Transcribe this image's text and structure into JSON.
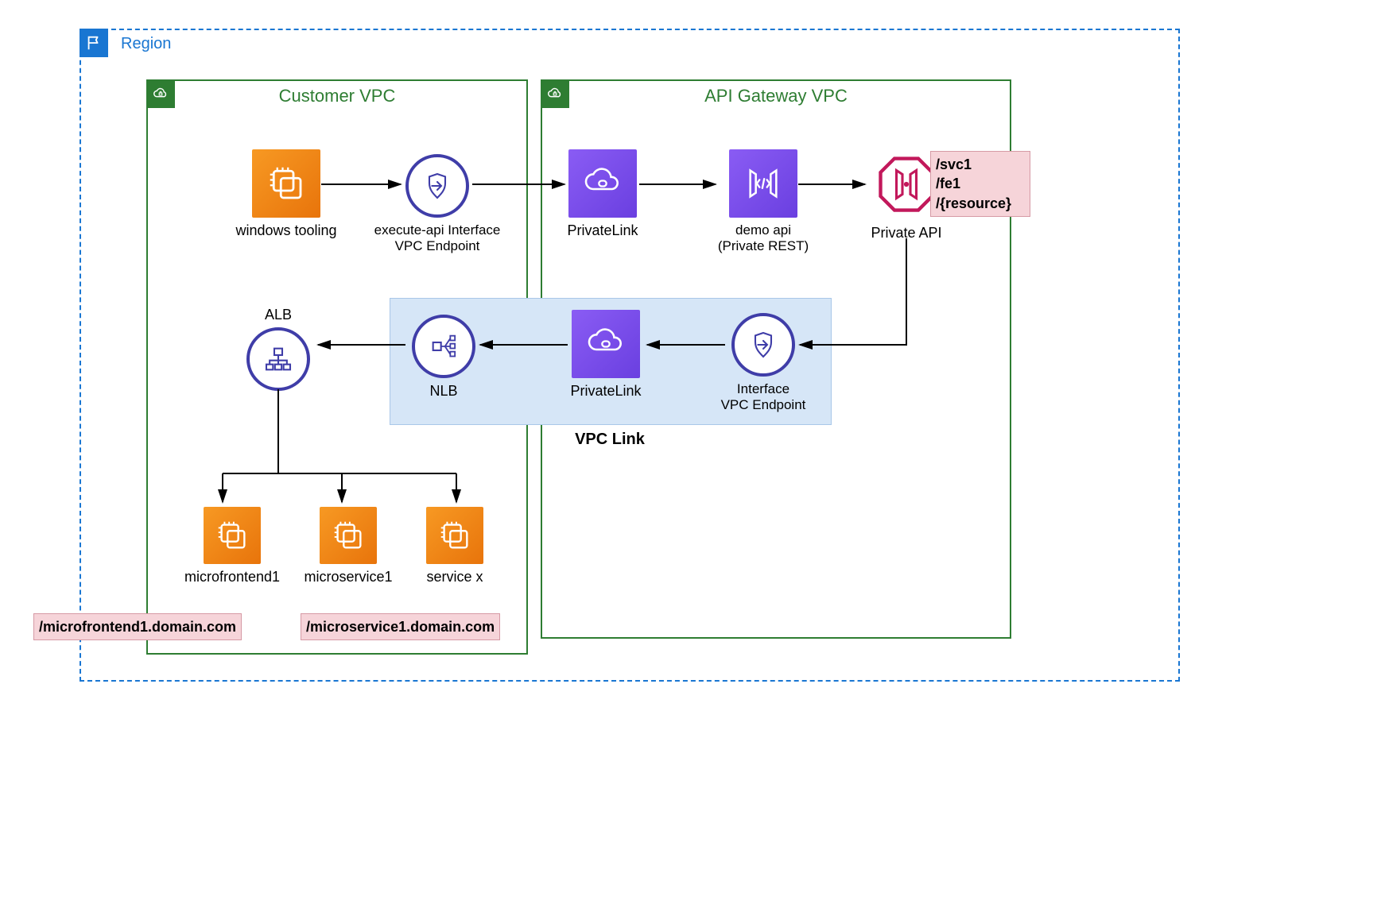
{
  "region": {
    "label": "Region"
  },
  "customer_vpc": {
    "label": "Customer VPC"
  },
  "apigw_vpc": {
    "label": "API Gateway VPC"
  },
  "vpclink": {
    "label": "VPC Link"
  },
  "nodes": {
    "windows_tooling": {
      "label": "windows tooling"
    },
    "execapi_endpoint": {
      "label_l1": "execute-api Interface",
      "label_l2": "VPC Endpoint"
    },
    "privatelink_top": {
      "label": "PrivateLink"
    },
    "demo_api": {
      "label_l1": "demo api",
      "label_l2": "(Private REST)"
    },
    "private_api": {
      "label": "Private API"
    },
    "alb": {
      "label": "ALB"
    },
    "nlb": {
      "label": "NLB"
    },
    "privatelink_mid": {
      "label": "PrivateLink"
    },
    "iface_endpoint": {
      "label_l1": "Interface",
      "label_l2": "VPC Endpoint"
    },
    "microfrontend1": {
      "label": "microfrontend1"
    },
    "microservice1": {
      "label": "microservice1"
    },
    "servicex": {
      "label": "service x"
    }
  },
  "routes": {
    "api_paths_l1": "/svc1",
    "api_paths_l2": "/fe1",
    "api_paths_l3": "/{resource}",
    "mfe_domain": "/microfrontend1.domain.com",
    "msvc_domain": "/microservice1.domain.com"
  }
}
